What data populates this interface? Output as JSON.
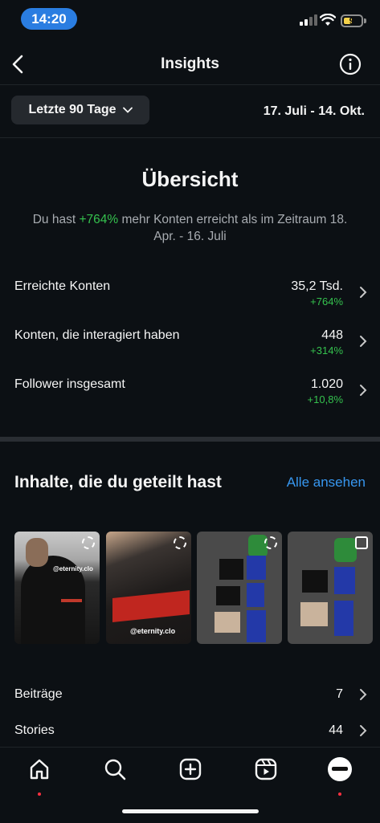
{
  "status_bar": {
    "time": "14:20",
    "battery": "9"
  },
  "header": {
    "title": "Insights"
  },
  "period": {
    "selected": "Letzte 90 Tage",
    "date_range": "17. Juli - 14. Okt."
  },
  "overview": {
    "title": "Übersicht",
    "text_prefix": "Du hast ",
    "text_highlight": "+764%",
    "text_suffix": " mehr Konten erreicht als im Zeitraum 18. Apr. - 16. Juli"
  },
  "metrics": [
    {
      "label": "Erreichte Konten",
      "value": "35,2 Tsd.",
      "change": "+764%"
    },
    {
      "label": "Konten, die interagiert haben",
      "value": "448",
      "change": "+314%"
    },
    {
      "label": "Follower insgesamt",
      "value": "1.020",
      "change": "+10,8%"
    }
  ],
  "content": {
    "title": "Inhalte, die du geteilt hast",
    "see_all": "Alle ansehen",
    "thumbnails": [
      {
        "caption": "@eternity.clo"
      },
      {
        "caption": "@eternity.clo"
      },
      {
        "caption": ""
      },
      {
        "caption": ""
      }
    ]
  },
  "list": [
    {
      "label": "Beiträge",
      "value": "7"
    },
    {
      "label": "Stories",
      "value": "44"
    }
  ],
  "colors": {
    "background": "#0c1014",
    "accent_blue": "#3797f0",
    "positive_green": "#35c24e",
    "notification_red": "#ff3040"
  },
  "nav": {
    "icons": [
      "home-icon",
      "search-icon",
      "create-icon",
      "reels-icon",
      "profile-avatar"
    ]
  }
}
